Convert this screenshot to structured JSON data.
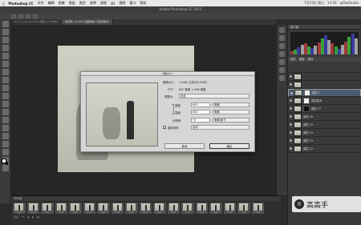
{
  "menubar": {
    "app": "Photoshop CC",
    "items": [
      "文件",
      "编辑",
      "图像",
      "图层",
      "类型",
      "选择",
      "滤镜",
      "3D",
      "视图",
      "窗口",
      "帮助"
    ],
    "right": [
      "7月23日 周日",
      "13:20",
      "@TaoStudio"
    ]
  },
  "window_title": "Adobe Photoshop CC 2015",
  "options": [
    "",
    "",
    "",
    ""
  ],
  "tabs": [
    {
      "label": "0 1 1 1.psd @ 100% (图层 1, RGB/8)"
    },
    {
      "label": "未标题-1 @ 50% (图层副本, 灰度蒙版/8)"
    }
  ],
  "dialog": {
    "title": "图像大小",
    "size_label": "图像大小:",
    "size_value": "1.03M (之前为3.34M)",
    "dimensions_label": "尺寸:",
    "dimensions_value": "600 像素 × 600 像素",
    "fit_label": "调整为:",
    "fit_value": "自定",
    "width_label": "宽度:",
    "width_value": "600",
    "width_unit": "像素",
    "height_label": "高度:",
    "height_value": "600",
    "height_unit": "像素",
    "resolution_label": "分辨率:",
    "resolution_value": "72",
    "resolution_unit": "像素/英寸",
    "resample_label": "重新采样:",
    "resample_value": "自动",
    "cancel": "取消",
    "ok": "确定"
  },
  "timeline": {
    "title": "时间轴",
    "frames": [
      "0.2s",
      "0.2s",
      "0.2s",
      "0.2s",
      "0.2s",
      "0.2s",
      "0.2s",
      "0.2s",
      "0.2s",
      "0.2s",
      "0.2s",
      "0.2s",
      "0.2s",
      "0.2s",
      "0.2s",
      "0.2s",
      "0.2s",
      "0.2s"
    ],
    "loop": "永远"
  },
  "panels": {
    "histogram_title": "直方图",
    "layers_tabs": [
      "图层",
      "通道",
      "路径"
    ],
    "layers": [
      {
        "name": "",
        "selected": false,
        "mask": "none"
      },
      {
        "name": "",
        "selected": false,
        "mask": "none"
      },
      {
        "name": "图层 1",
        "selected": true,
        "mask": "white"
      },
      {
        "name": "图层副本",
        "selected": false,
        "mask": "white"
      },
      {
        "name": "图层 27",
        "selected": false,
        "mask": "black"
      },
      {
        "name": "图层 26",
        "selected": false,
        "mask": "none"
      },
      {
        "name": "图层 25",
        "selected": false,
        "mask": "none"
      },
      {
        "name": "图层 24",
        "selected": false,
        "mask": "none"
      },
      {
        "name": "图层 23",
        "selected": false,
        "mask": "none"
      },
      {
        "name": "图层 22",
        "selected": false,
        "mask": "none"
      }
    ]
  },
  "watermark": {
    "text": "高高手"
  }
}
